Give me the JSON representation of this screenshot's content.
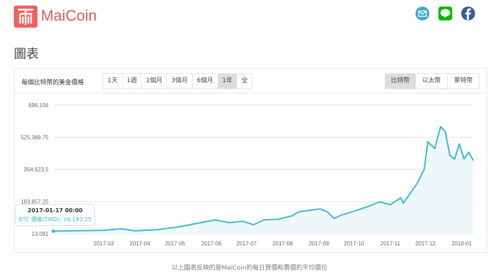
{
  "header": {
    "brand": "MaiCoin",
    "logo_icon": "maicoin-logo-icon",
    "social": [
      "email-icon",
      "line-icon",
      "facebook-icon"
    ],
    "line_text": "LINE"
  },
  "page_title": "圖表",
  "toolbar": {
    "label": "每個比特幣的美金價格",
    "ranges": [
      "1天",
      "1週",
      "1個月",
      "3個月",
      "6個月",
      "1年",
      "全"
    ],
    "active_range": "1年",
    "coins": [
      "比特幣",
      "以太幣",
      "萊特幣"
    ],
    "active_coin": "比特幣"
  },
  "tooltip": {
    "date": "2017-01-17 00:00",
    "value_text": "BTC 價格(TWD): 26,183.25"
  },
  "footer": "以上圖表反映的是MaiCoin的每日買價和賣價的平均價位",
  "colors": {
    "brand": "#f0625f",
    "line": "#3bb8d0",
    "email": "#3fa9d6",
    "line_app": "#00b900",
    "facebook": "#3b5998"
  },
  "chart_data": {
    "type": "area",
    "series": [
      {
        "name": "BTC 價格(TWD)",
        "points": [
          [
            "2017-01-17",
            26183
          ],
          [
            "2017-03-01",
            31000
          ],
          [
            "2017-03-16",
            39000
          ],
          [
            "2017-03-28",
            28000
          ],
          [
            "2017-04-17",
            35000
          ],
          [
            "2017-05-05",
            50000
          ],
          [
            "2017-05-23",
            72000
          ],
          [
            "2017-06-04",
            86000
          ],
          [
            "2017-06-16",
            72000
          ],
          [
            "2017-06-28",
            79000
          ],
          [
            "2017-07-07",
            61000
          ],
          [
            "2017-07-16",
            86000
          ],
          [
            "2017-07-28",
            90000
          ],
          [
            "2017-08-09",
            108000
          ],
          [
            "2017-08-15",
            130000
          ],
          [
            "2017-09-02",
            145000
          ],
          [
            "2017-09-08",
            130000
          ],
          [
            "2017-09-14",
            94000
          ],
          [
            "2017-09-20",
            112000
          ],
          [
            "2017-10-02",
            134000
          ],
          [
            "2017-10-14",
            160000
          ],
          [
            "2017-10-23",
            182000
          ],
          [
            "2017-11-01",
            167000
          ],
          [
            "2017-11-10",
            204000
          ],
          [
            "2017-11-12",
            175000
          ],
          [
            "2017-11-18",
            226000
          ],
          [
            "2017-11-24",
            281000
          ],
          [
            "2017-11-30",
            355000
          ],
          [
            "2017-12-03",
            501000
          ],
          [
            "2017-12-09",
            465000
          ],
          [
            "2017-12-14",
            582000
          ],
          [
            "2017-12-18",
            556000
          ],
          [
            "2017-12-22",
            428000
          ],
          [
            "2017-12-26",
            410000
          ],
          [
            "2017-12-30",
            490000
          ],
          [
            "2018-01-03",
            410000
          ],
          [
            "2018-01-07",
            446000
          ],
          [
            "2018-01-11",
            402000
          ]
        ]
      }
    ],
    "yticks": [
      "696,156",
      "525,389.75",
      "354,623.5",
      "183,857.25",
      "13,091"
    ],
    "ytick_values": [
      696156,
      525389.75,
      354623.5,
      183857.25,
      13091
    ],
    "ylim": [
      13091,
      696156
    ],
    "xticks": [
      "2017-03",
      "2017-04",
      "2017-05",
      "2017-06",
      "2017-07",
      "2017-08",
      "2017-09",
      "2017-10",
      "2017-11",
      "2017-12",
      "2018-01"
    ],
    "xlim": [
      "2017-01-17",
      "2018-01-11"
    ],
    "grid": true
  }
}
